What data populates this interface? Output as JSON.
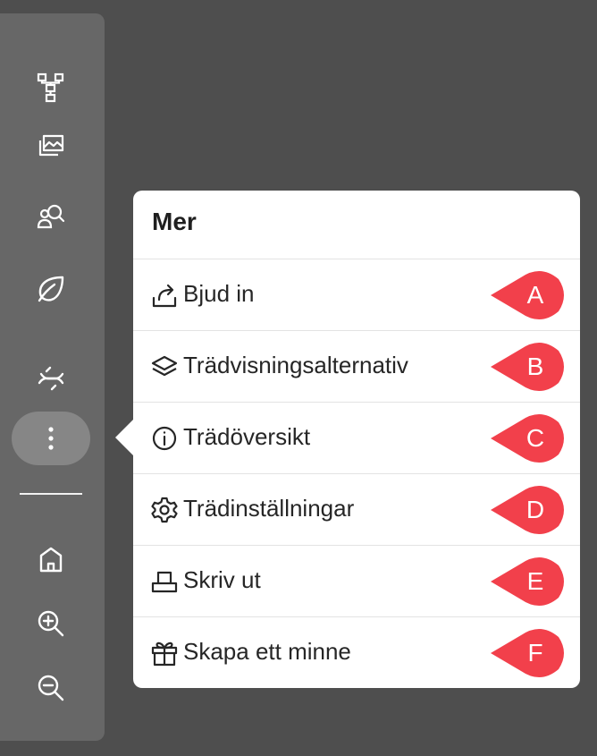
{
  "sidebar": {
    "icons": [
      "family-tree-icon",
      "gallery-icon",
      "search-person-icon",
      "leaf-icon",
      "dna-icon",
      "more-vertical-icon",
      "home-icon",
      "zoom-in-icon",
      "zoom-out-icon"
    ]
  },
  "menu": {
    "title": "Mer",
    "items": [
      {
        "label": "Bjud in",
        "icon": "share-icon",
        "marker": "A"
      },
      {
        "label": "Trädvisningsalternativ",
        "icon": "layers-icon",
        "marker": "B"
      },
      {
        "label": "Trädöversikt",
        "icon": "info-icon",
        "marker": "C"
      },
      {
        "label": "Trädinställningar",
        "icon": "settings-icon",
        "marker": "D"
      },
      {
        "label": "Skriv ut",
        "icon": "print-icon",
        "marker": "E"
      },
      {
        "label": "Skapa ett minne",
        "icon": "gift-icon",
        "marker": "F"
      }
    ]
  },
  "colors": {
    "background": "#4e4e4e",
    "sidebar": "#676767",
    "active_button": "#868686",
    "marker": "#f2404b",
    "menu_background": "#ffffff"
  }
}
